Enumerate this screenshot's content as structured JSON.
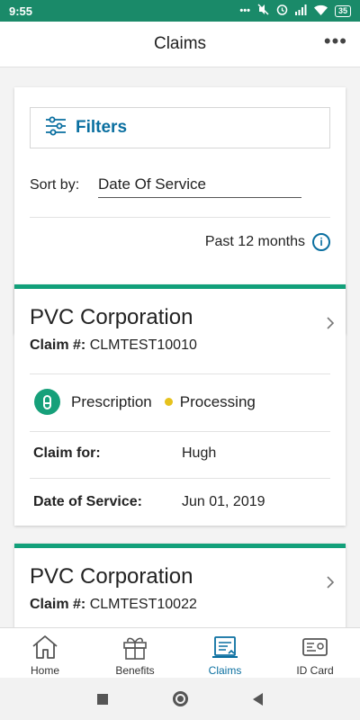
{
  "status_bar": {
    "time": "9:55",
    "battery": "35"
  },
  "header": {
    "title": "Claims",
    "more_label": "•••"
  },
  "filters": {
    "button_label": "Filters",
    "sort_label": "Sort by:",
    "sort_value": "Date Of Service",
    "period": "Past 12 months"
  },
  "claims": [
    {
      "company": "PVC Corporation",
      "claim_label": "Claim #:",
      "claim_number": "CLMTEST10010",
      "type": "Prescription",
      "status": "Processing",
      "claim_for_label": "Claim for:",
      "claim_for": "Hugh",
      "dos_label": "Date of Service:",
      "dos": "Jun 01, 2019"
    },
    {
      "company": "PVC Corporation",
      "claim_label": "Claim #:",
      "claim_number": "CLMTEST10022"
    }
  ],
  "bottom_nav": [
    {
      "label": "Home",
      "icon": "home-icon"
    },
    {
      "label": "Benefits",
      "icon": "gift-icon"
    },
    {
      "label": "Claims",
      "icon": "claims-icon",
      "active": true
    },
    {
      "label": "ID Card",
      "icon": "id-card-icon"
    }
  ],
  "colors": {
    "accent": "#12a07a",
    "link": "#0a6fa0",
    "status_dot": "#e6c21d"
  }
}
